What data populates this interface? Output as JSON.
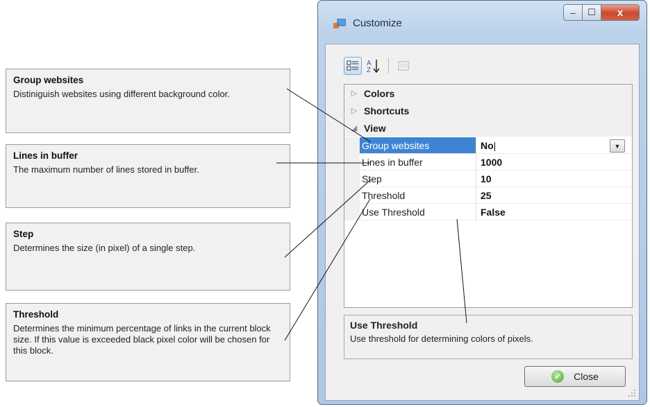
{
  "callouts": {
    "group_websites": {
      "title": "Group websites",
      "text": "Distiniguish websites using different background color."
    },
    "lines_in_buffer": {
      "title": "Lines in buffer",
      "text": "The maximum number of lines stored in buffer."
    },
    "step": {
      "title": "Step",
      "text": "Determines the size (in pixel) of a single step."
    },
    "threshold": {
      "title": "Threshold",
      "text": "Determines the minimum percentage of links in the current block size. If this value is exceeded black pixel color will be chosen for this block."
    }
  },
  "window": {
    "title": "Customize",
    "controls": {
      "minimize": "–",
      "maximize": "☐",
      "close": "x"
    }
  },
  "toolbar": {
    "categorized_icon": "categorized-icon",
    "alphabetical_icon": "sort-az-icon",
    "property_pages_icon": "property-pages-icon"
  },
  "grid": {
    "categories": [
      {
        "label": "Colors",
        "expanded": false
      },
      {
        "label": "Shortcuts",
        "expanded": false
      },
      {
        "label": "View",
        "expanded": true
      }
    ],
    "properties": [
      {
        "name": "Group websites",
        "value": "No",
        "selected": true
      },
      {
        "name": "Lines in buffer",
        "value": "1000"
      },
      {
        "name": "Step",
        "value": "10"
      },
      {
        "name": "Threshold",
        "value": "25"
      },
      {
        "name": "Use Threshold",
        "value": "False"
      }
    ]
  },
  "description": {
    "title": "Use Threshold",
    "text": "Use threshold for determining colors of pixels."
  },
  "buttons": {
    "close": "Close"
  },
  "colors": {
    "selection": "#3d85d4",
    "window_frame": "#aec7e3",
    "callout_bg": "#f1f1f1"
  }
}
